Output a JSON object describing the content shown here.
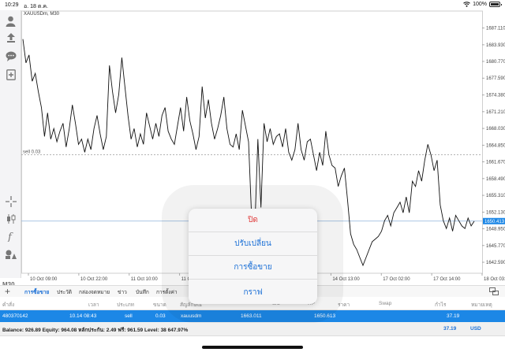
{
  "status_bar": {
    "time": "10:29",
    "date": "อ. 18 ต.ค.",
    "battery": "100%"
  },
  "chart": {
    "symbol_label": "XAUUSDm, M30",
    "sell_line_label": "sell 0.03",
    "current_price_label": "1650.413"
  },
  "toolbar": {
    "icons": [
      "person-icon",
      "download-arrow-icon",
      "chat-icon",
      "add-document-icon",
      "crosshair-icon",
      "candlestick-icon",
      "function-icon",
      "objects-icon"
    ],
    "timeframe": "M30"
  },
  "chart_data": {
    "type": "line",
    "title": "XAUUSDm, M30",
    "price_ticks": [
      "1687.110",
      "1683.930",
      "1680.770",
      "1677.590",
      "1674.380",
      "1671.210",
      "1668.030",
      "1664.850",
      "1661.670",
      "1658.490",
      "1655.310",
      "1652.130",
      "1648.950",
      "1645.770",
      "1642.590"
    ],
    "time_ticks": [
      "10 Oct 09:00",
      "10 Oct 22:00",
      "11 Oct 10:00",
      "11 Oct 23:00",
      "12 Oct 11:00",
      "13 Oct 01:00",
      "14 Oct 13:00",
      "17 Oct 02:00",
      "17 Oct 14:00",
      "18 Oct 03:00"
    ],
    "ylim": [
      1640.5,
      1689.6
    ],
    "sell_level": 1663.011,
    "current_price": 1650.413,
    "series": [
      {
        "values": [
          1685.0,
          1680.5,
          1682.0,
          1677.0,
          1678.5,
          1675.0,
          1672.0,
          1666.5,
          1671.0,
          1666.0,
          1668.0,
          1665.5,
          1667.5,
          1669.0,
          1664.5,
          1668.0,
          1672.5,
          1669.0,
          1665.0,
          1666.0,
          1663.5,
          1666.0,
          1664.0,
          1668.0,
          1670.5,
          1667.0,
          1664.0,
          1666.5,
          1680.0,
          1675.0,
          1671.0,
          1674.5,
          1681.5,
          1676.0,
          1670.5,
          1666.0,
          1668.0,
          1664.5,
          1667.0,
          1665.0,
          1671.0,
          1668.5,
          1666.0,
          1669.0,
          1666.5,
          1670.5,
          1672.0,
          1667.5,
          1666.0,
          1665.0,
          1668.5,
          1672.0,
          1667.5,
          1674.0,
          1669.5,
          1667.0,
          1664.0,
          1666.5,
          1676.0,
          1670.0,
          1673.5,
          1669.0,
          1666.0,
          1668.0,
          1670.5,
          1674.0,
          1668.0,
          1665.0,
          1664.5,
          1667.0,
          1664.0,
          1671.5,
          1668.5,
          1665.5,
          1651.0,
          1648.5,
          1666.0,
          1653.0,
          1669.0,
          1665.5,
          1668.0,
          1665.0,
          1666.5,
          1667.0,
          1664.5,
          1668.0,
          1663.5,
          1662.0,
          1664.0,
          1669.0,
          1664.0,
          1662.0,
          1665.5,
          1666.0,
          1663.0,
          1660.0,
          1663.5,
          1661.0,
          1667.5,
          1663.0,
          1661.0,
          1660.5,
          1657.0,
          1659.0,
          1660.5,
          1654.5,
          1648.0,
          1646.0,
          1645.0,
          1643.5,
          1642.0,
          1643.5,
          1645.0,
          1646.5,
          1647.0,
          1647.5,
          1648.5,
          1650.5,
          1651.5,
          1649.5,
          1652.0,
          1653.0,
          1654.0,
          1652.0,
          1655.0,
          1652.0,
          1658.0,
          1657.0,
          1660.0,
          1658.0,
          1662.0,
          1665.0,
          1663.0,
          1660.0,
          1662.0,
          1653.5,
          1650.5,
          1649.0,
          1651.0,
          1648.5,
          1651.5,
          1650.5,
          1649.5,
          1649.0,
          1651.0,
          1649.5,
          1650.4
        ]
      }
    ]
  },
  "bottom_tabs": {
    "items": [
      "การซื้อขาย",
      "ประวัติ",
      "กล่องจดหมาย",
      "ข่าว",
      "บันทึก",
      "การตั้งค่า"
    ],
    "active": 0
  },
  "table": {
    "headers": [
      "คำสั่ง",
      "เวลา",
      "ประเภท",
      "ขนาด",
      "สัญลักษณ์",
      "",
      "S/L",
      "T/P",
      "ราคา",
      "Swap",
      "กำไร",
      "หมายเหตุ"
    ],
    "row": {
      "order": "480370142",
      "time": "10.14 08:43",
      "type": "sell",
      "size": "0.03",
      "symbol": "xauusdm",
      "open_price": "1663.011",
      "price": "1650.613",
      "profit": "37.19"
    }
  },
  "balance": {
    "text": "Balance: 926.89 Equity: 964.08 หลักประกัน: 2.49 ฟรี: 961.59 Level: 38 647.97%",
    "profit": "37.19",
    "currency": "USD"
  },
  "popup": {
    "items": [
      "ปิด",
      "ปรับเปลี่ยน",
      "การซื้อขาย",
      "กราฟ"
    ]
  },
  "colors": {
    "accent": "#1a6fd6",
    "danger": "#e03a3a",
    "row_selected": "#1c87e6",
    "price_line": "#8fb2dc"
  }
}
